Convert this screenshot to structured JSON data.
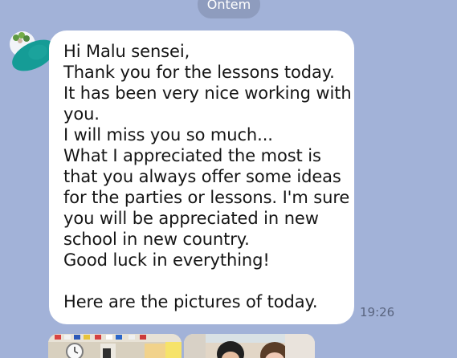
{
  "chat": {
    "date_label": "Ontem",
    "time": "19:26"
  },
  "message": {
    "lines": [
      "Hi Malu sensei,",
      "Thank you for the lessons today.",
      "It has been very nice working with",
      "you.",
      "I will miss you so much...",
      "What I appreciated the most is",
      "that you always offer some ideas",
      "for the parties or lessons. I'm sure",
      "you will be appreciated in new",
      "school in new country.",
      "Good luck in everything!",
      "",
      "Here are the pictures of today."
    ]
  },
  "icons": {
    "avatar": "avatar-icon"
  }
}
